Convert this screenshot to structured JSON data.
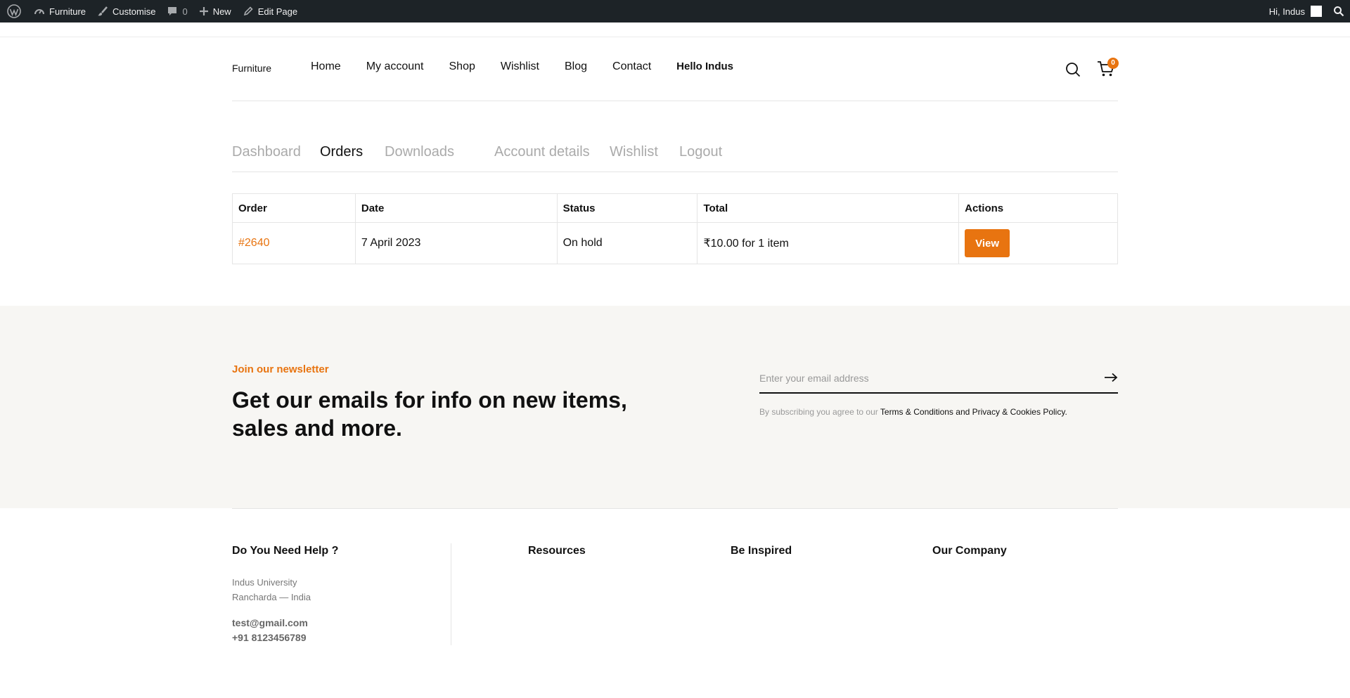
{
  "admin_bar": {
    "site_name": "Furniture",
    "customise": "Customise",
    "comments_count": "0",
    "new": "New",
    "edit_page": "Edit Page",
    "greeting": "Hi, Indus"
  },
  "header": {
    "logo": "Furniture",
    "nav": [
      "Home",
      "My account",
      "Shop",
      "Wishlist",
      "Blog",
      "Contact",
      "Hello Indus"
    ],
    "cart_count": "0"
  },
  "account_tabs": [
    "Dashboard",
    "Orders",
    "Downloads",
    "Account details",
    "Wishlist",
    "Logout"
  ],
  "orders": {
    "columns": [
      "Order",
      "Date",
      "Status",
      "Total",
      "Actions"
    ],
    "rows": [
      {
        "order": "#2640",
        "date": "7 April 2023",
        "status": "On hold",
        "total": "₹10.00 for 1 item",
        "action": "View"
      }
    ]
  },
  "newsletter": {
    "eyebrow": "Join our newsletter",
    "heading": "Get our emails for info on new items, sales and more.",
    "placeholder": "Enter your email address",
    "terms_prefix": "By subscribing you agree to our",
    "terms_links": "Terms & Conditions and Privacy & Cookies Policy."
  },
  "footer": {
    "help_title": "Do You Need Help ?",
    "address_line1": "Indus University",
    "address_line2": "Rancharda — India",
    "email": "test@gmail.com",
    "phone": "+91 8123456789",
    "resources_title": "Resources",
    "inspired_title": "Be Inspired",
    "company_title": "Our Company"
  },
  "colors": {
    "accent": "#e87410",
    "admin_bar_bg": "#1d2327",
    "newsletter_bg": "#f7f6f3"
  }
}
